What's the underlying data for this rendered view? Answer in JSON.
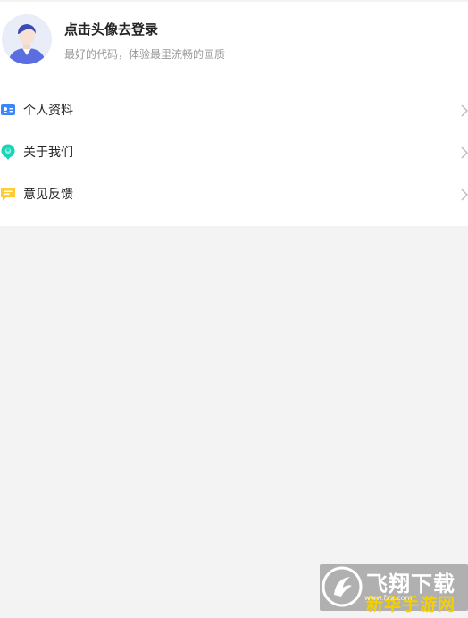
{
  "profile": {
    "title": "点击头像去登录",
    "subtitle": "最好的代码，体验最里流畅的画质",
    "avatar_icon": "default-user-avatar"
  },
  "menu": {
    "items": [
      {
        "label": "个人资料",
        "icon": "profile-card-icon",
        "color": "#3a86ff"
      },
      {
        "label": "关于我们",
        "icon": "about-us-icon",
        "color": "#19d4b8"
      },
      {
        "label": "意见反馈",
        "icon": "feedback-icon",
        "color": "#ffcc33"
      }
    ]
  },
  "watermark": {
    "line1": "飞翔下载",
    "line2": "新华手游网",
    "url": "www.fxx.com"
  },
  "colors": {
    "background": "#f3f3f3",
    "panel": "#ffffff",
    "title": "#222222",
    "subtitle": "#999999",
    "chevron": "#bbbbbb"
  }
}
